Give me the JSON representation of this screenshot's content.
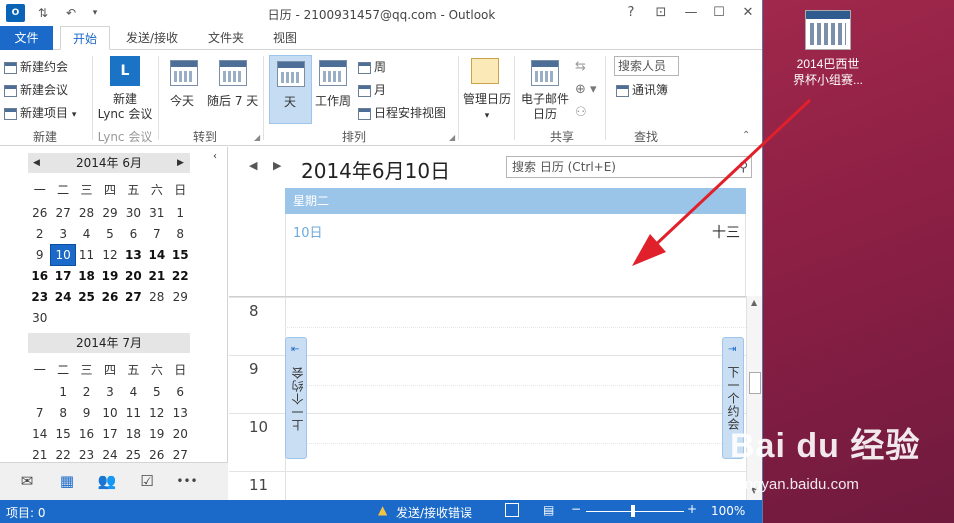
{
  "window": {
    "title": "日历 - 2100931457@qq.com - Outlook",
    "app_icon": "O"
  },
  "controls": {
    "help": "?",
    "restore_ribbon": "⊡",
    "minimize": "—",
    "maximize": "☐",
    "close": "✕"
  },
  "tabs": [
    "文件",
    "开始",
    "发送/接收",
    "文件夹",
    "视图"
  ],
  "ribbon": {
    "new": {
      "appointment": "新建约会",
      "meeting": "新建会议",
      "items": "新建项目",
      "items_arrow": "▾",
      "label": "新建"
    },
    "lync": {
      "line1": "新建",
      "line2": "Lync 会议",
      "label": "Lync 会议"
    },
    "goto": {
      "today": "今天",
      "next7": "随后 7 天",
      "label": "转到"
    },
    "arrange": {
      "day": "天",
      "workweek": "工作周",
      "week": "周",
      "month": "月",
      "schedule": "日程安排视图",
      "label": "排列"
    },
    "manage": {
      "label_btn": "管理日历"
    },
    "share": {
      "email_line1": "电子邮件",
      "email_line2": "日历",
      "label": "共享"
    },
    "find": {
      "search_people": "搜索人员",
      "address_book": "通讯簿",
      "label": "查找"
    }
  },
  "mini_cal": {
    "day_names": [
      "一",
      "二",
      "三",
      "四",
      "五",
      "六",
      "日"
    ],
    "june": {
      "title": "2014年 6月",
      "weeks": [
        [
          "26",
          "27",
          "28",
          "29",
          "30",
          "31",
          "1"
        ],
        [
          "2",
          "3",
          "4",
          "5",
          "6",
          "7",
          "8"
        ],
        [
          "9",
          "10",
          "11",
          "12",
          "13",
          "14",
          "15"
        ],
        [
          "16",
          "17",
          "18",
          "19",
          "20",
          "21",
          "22"
        ],
        [
          "23",
          "24",
          "25",
          "26",
          "27",
          "28",
          "29"
        ],
        [
          "30"
        ]
      ],
      "today": "10"
    },
    "july": {
      "title": "2014年 7月",
      "weeks": [
        [
          "",
          "1",
          "2",
          "3",
          "4",
          "5",
          "6"
        ],
        [
          "7",
          "8",
          "9",
          "10",
          "11",
          "12",
          "13"
        ],
        [
          "14",
          "15",
          "16",
          "17",
          "18",
          "19",
          "20"
        ],
        [
          "21",
          "22",
          "23",
          "24",
          "25",
          "26",
          "27"
        ]
      ]
    }
  },
  "nav_icons": [
    "mail-icon",
    "calendar-icon",
    "people-icon",
    "tasks-icon",
    "more-icon"
  ],
  "nav_more": "•••",
  "main": {
    "date_header": "2014年6月10日",
    "search_placeholder": "搜索 日历 (Ctrl+E)",
    "weekday": "星期二",
    "day_num": "10日",
    "lunar": "十三",
    "hours": [
      "8",
      "9",
      "10",
      "11"
    ],
    "prev_appt": "上一个约会",
    "next_appt": "下一个约会"
  },
  "status": {
    "items": "项目: 0",
    "error": "发送/接收错误",
    "zoom": "100%"
  },
  "desktop": {
    "icon_label_1": "2014巴西世",
    "icon_label_2": "界杯小组赛..."
  },
  "watermark": {
    "logo": "Bai du 经验",
    "url": "jingyan.baidu.com"
  },
  "colors": {
    "accent": "#1b6ac9",
    "weekday_bar": "#9bc5e8",
    "arrow": "#e0202a",
    "desktop": "#8c1f44"
  }
}
